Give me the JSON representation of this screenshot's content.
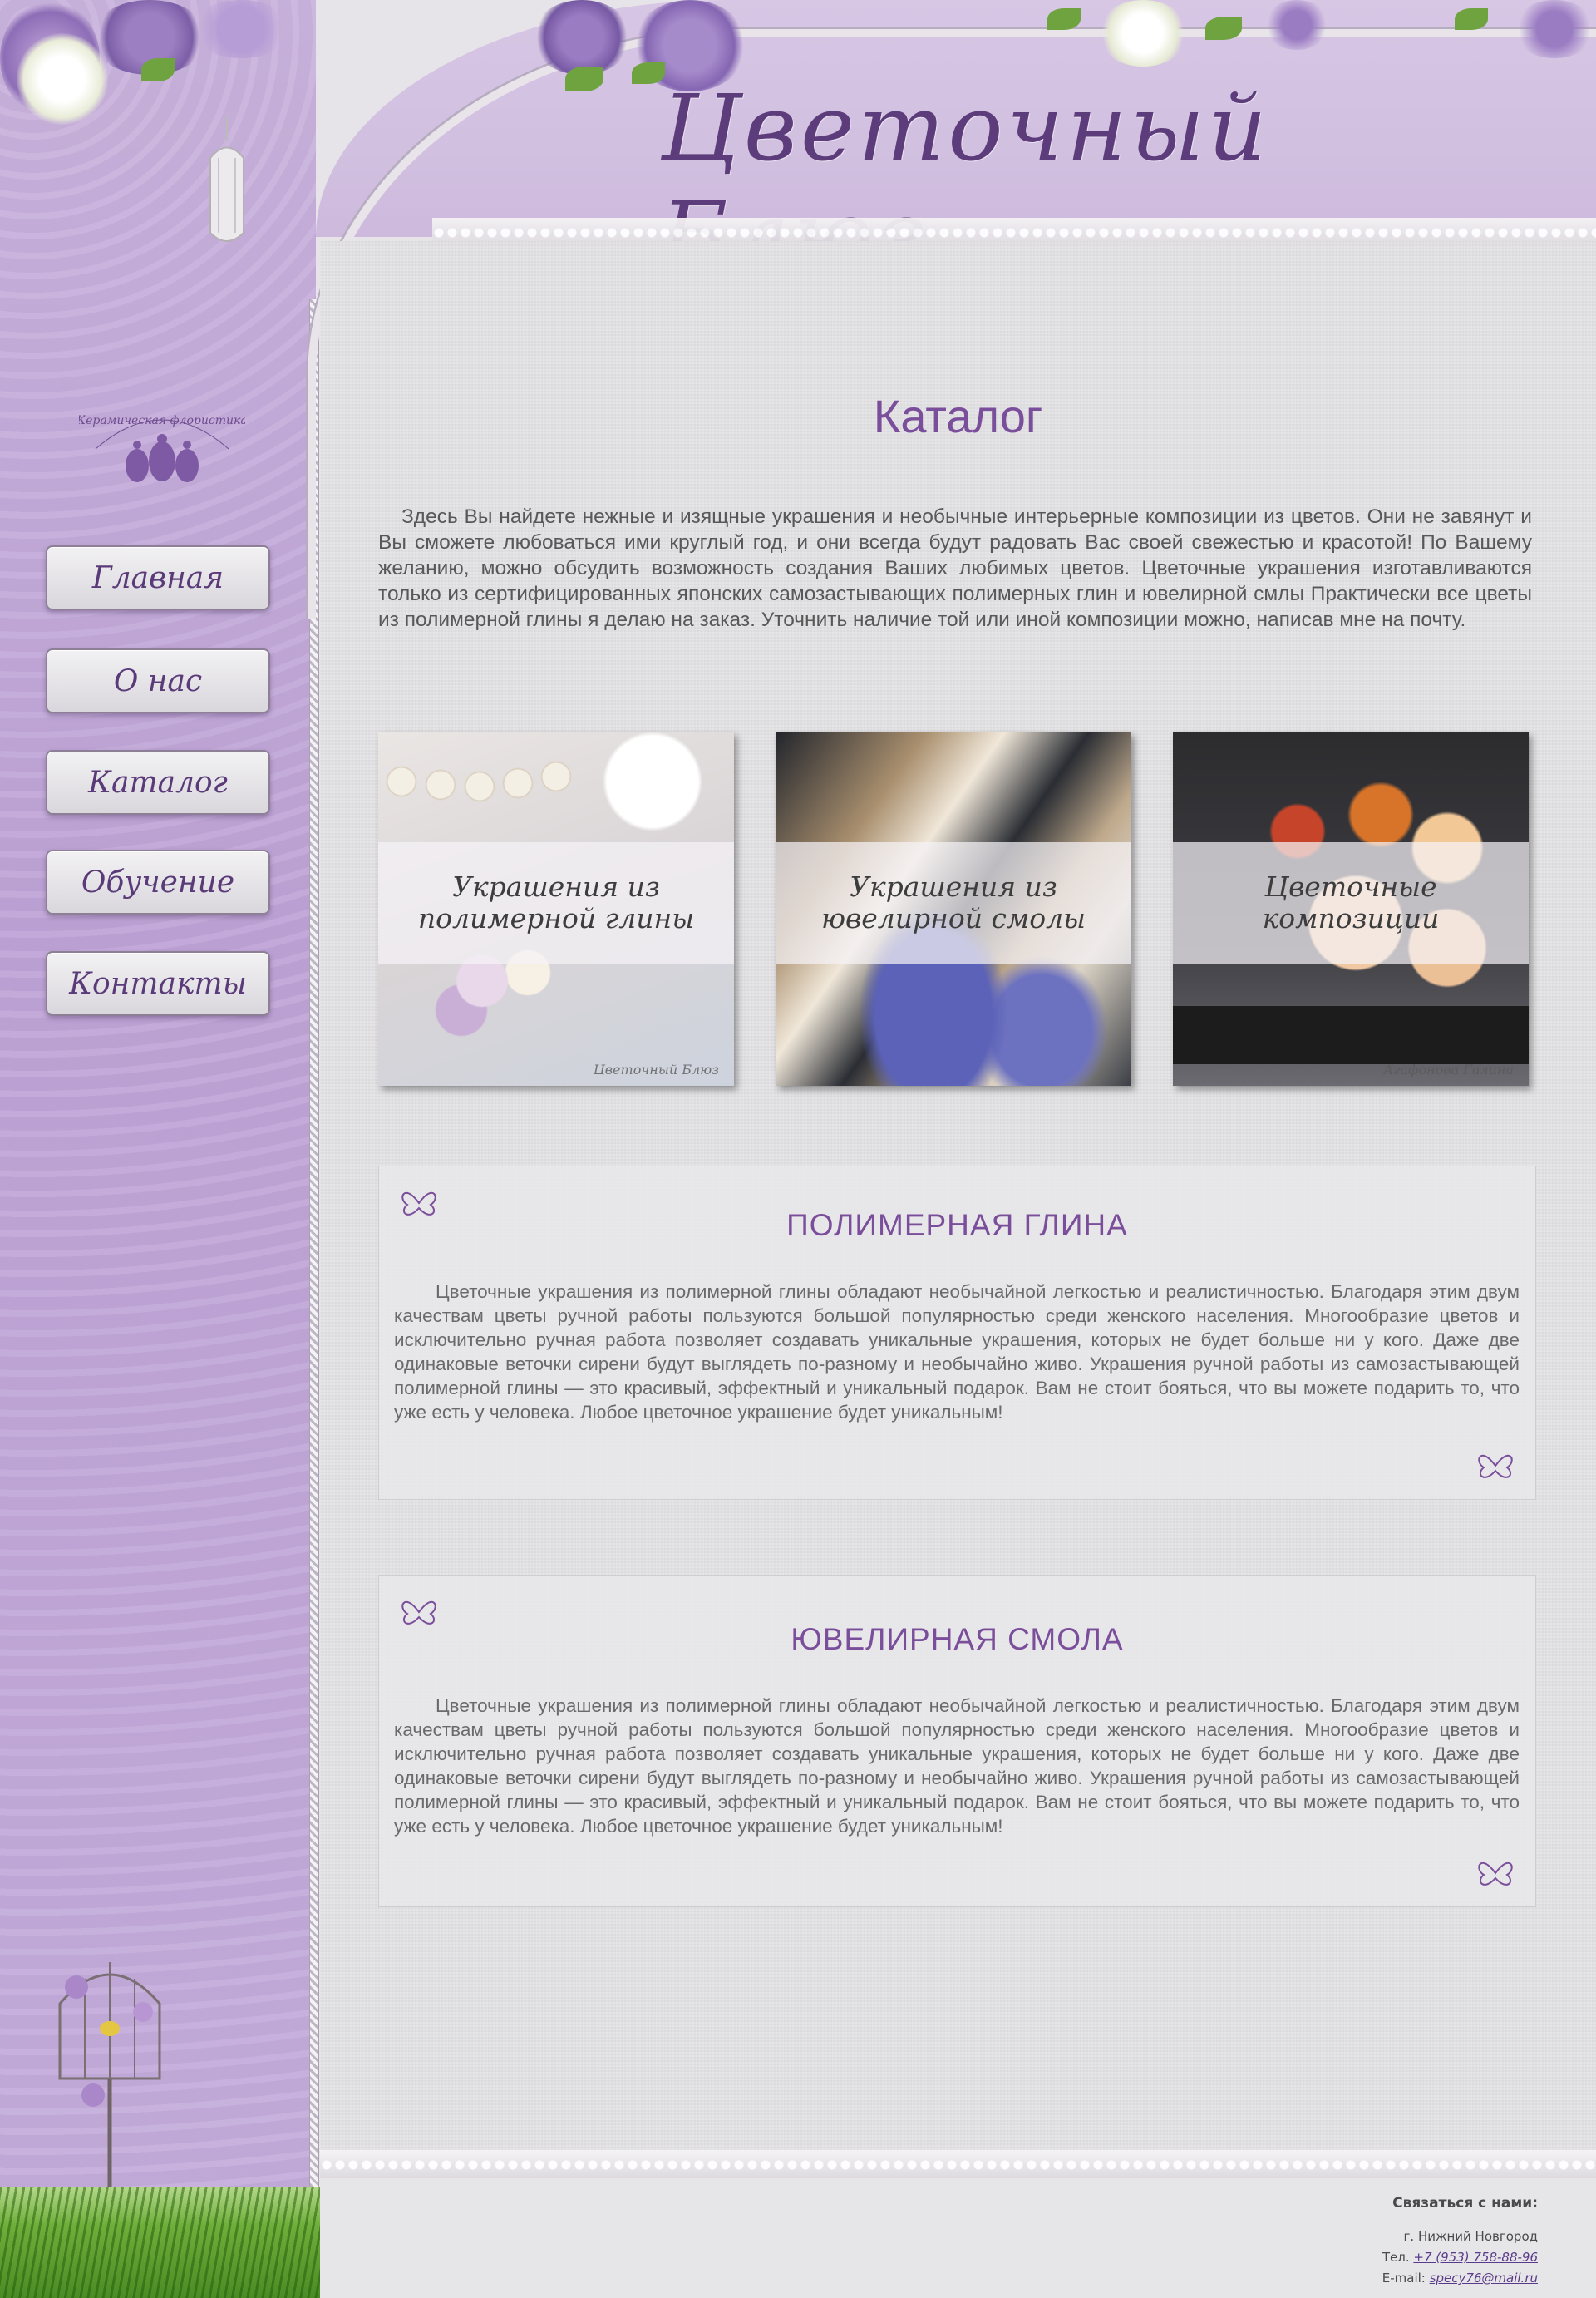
{
  "site": {
    "title": "Цветочный Блюз",
    "logo_text": "Керамическая флористика"
  },
  "colors": {
    "accent": "#7b4e9b",
    "sidebar": "#c4acdb",
    "paper": "#e3e2e4",
    "text": "#585858"
  },
  "nav": {
    "items": [
      {
        "label": "Главная"
      },
      {
        "label": "О нас"
      },
      {
        "label": "Каталог"
      },
      {
        "label": "Обучение"
      },
      {
        "label": "Контакты"
      }
    ]
  },
  "page": {
    "title": "Каталог",
    "intro": "Здесь Вы найдете нежные и изящные украшения и необычные интерьерные композиции из цветов. Они не завянут и Вы сможете любоваться ими круглый год, и они всегда будут радовать Вас своей свежестью и красотой! По Вашему желанию, можно обсудить возможность создания Ваших любимых цветов. Цветочные украшения изготавливаются только из сертифицированных японских самозастывающих полимерных глин и ювелирной смлы Практически все цветы из полимерной глины я делаю на заказ. Уточнить наличие той или иной композиции можно, написав мне на почту."
  },
  "catalog": {
    "cards": [
      {
        "label": "Украшения из\nполимерной глины",
        "watermark": "Цветочный Блюз"
      },
      {
        "label": "Украшения из\nювелирной смолы",
        "watermark": ""
      },
      {
        "label": "Цветочные\nкомпозиции",
        "watermark": "Агафонова Галина"
      }
    ]
  },
  "sections": [
    {
      "title": "ПОЛИМЕРНАЯ ГЛИНА",
      "text": "Цветочные украшения из полимерной глины обладают необычайной легкостью и реалистичностью. Благодаря этим двум качествам цветы ручной работы пользуются большой популярностью среди женского населения. Многообразие цветов и исключительно ручная работа позволяет создавать уникальные украшения, которых не будет больше ни у кого. Даже две одинаковые веточки сирени будут выглядеть по-разному и необычайно живо. Украшения ручной работы из самозастывающей полимерной глины — это красивый, эффектный и уникальный подарок. Вам не стоит бояться, что вы можете подарить то, что уже есть у человека. Любое цветочное украшение будет уникальным!"
    },
    {
      "title": "ЮВЕЛИРНАЯ СМОЛА",
      "text": "Цветочные украшения из полимерной глины обладают необычайной легкостью и реалистичностью. Благодаря этим двум качествам цветы ручной работы пользуются большой популярностью среди женского населения. Многообразие цветов и исключительно ручная работа позволяет создавать уникальные украшения, которых не будет больше ни у кого. Даже две одинаковые веточки сирени будут выглядеть по-разному и необычайно живо. Украшения ручной работы из самозастывающей полимерной глины — это красивый, эффектный и уникальный подарок. Вам не стоит бояться, что вы можете подарить то, что уже есть у человека. Любое цветочное украшение будет уникальным!"
    }
  ],
  "footer": {
    "contact_title": "Связаться с нами:",
    "city": "г. Нижний Новгород",
    "phone_label": "Тел.",
    "phone": "+7 (953) 758-88-96",
    "email_label": "E-mail:",
    "email": "specy76@mail.ru"
  }
}
